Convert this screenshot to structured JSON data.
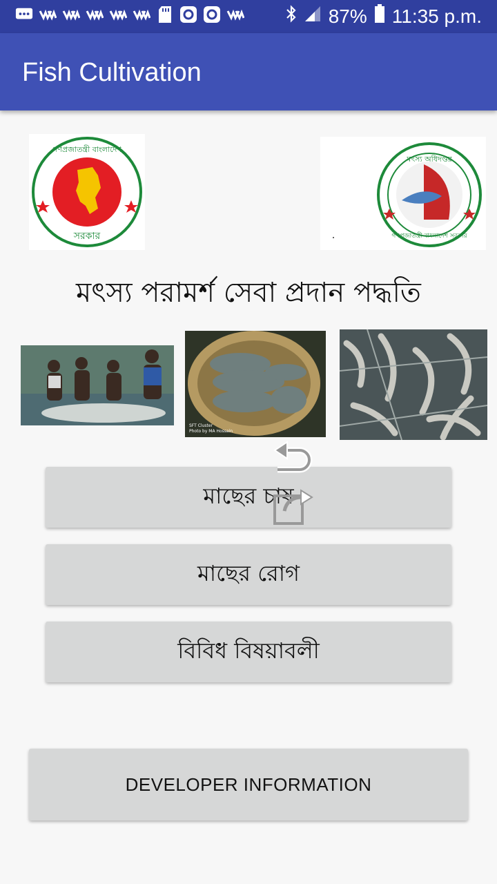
{
  "status_bar": {
    "battery_percent": "87%",
    "time": "11:35 p.m.",
    "icons": [
      "message-icon",
      "voicemail-icon",
      "voicemail-icon",
      "voicemail-icon",
      "voicemail-icon",
      "voicemail-icon",
      "sd-card-icon",
      "instagram-icon",
      "instagram-icon",
      "voicemail-icon",
      "bluetooth-icon",
      "signal-icon",
      "battery-icon"
    ]
  },
  "app_bar": {
    "title": "Fish Cultivation"
  },
  "heading": "মৎস্য পরামর্শ সেবা প্রদান পদ্ধতি",
  "logos": {
    "left": {
      "text_top": "গণপ্রজাতন্ত্রী বাংলাদেশ",
      "text_bottom": "সরকার"
    },
    "right": {
      "text_top": "মৎস্য অধিদপ্তর",
      "text_bottom": "গণপ্রজাতন্ত্রী বাংলাদেশ সরকার"
    }
  },
  "photos": [
    {
      "name": "fishermen-photo"
    },
    {
      "name": "tilapia-basket-photo",
      "caption1": "SFT Cluster",
      "caption2": "Photo by MA Hossain"
    },
    {
      "name": "shrimp-photo"
    }
  ],
  "buttons": {
    "fish_cultivation": "মাছের চাষ",
    "fish_disease": "মাছের রোগ",
    "misc_topics": "বিবিধ বিষয়াবলী",
    "developer_info": "DEVELOPER INFORMATION"
  },
  "colors": {
    "status_bar": "#303f9f",
    "app_bar": "#3f51b5",
    "button_bg": "#d6d7d7",
    "background": "#f7f7f7"
  }
}
